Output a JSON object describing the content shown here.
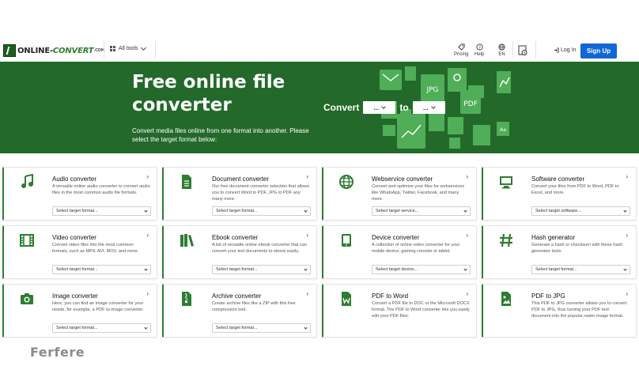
{
  "header": {
    "logo_main": "ONLINE-",
    "logo_accent": "CONVERT",
    "logo_suffix": ".COM",
    "all_tools": "All tools",
    "pricing": "Pricing",
    "help": "Help",
    "language": "EN",
    "login": "Log In",
    "signup": "Sign Up"
  },
  "hero": {
    "title": "Free online file converter",
    "subtitle": "Convert media files online from one format into another. Please select the target format below:",
    "convert_label": "Convert",
    "to_label": "to",
    "from_value": "...",
    "to_value": "...",
    "art_labels": [
      "JPG",
      "PDF",
      "Aa"
    ]
  },
  "cards": [
    {
      "title": "Audio converter",
      "desc": "A versatile online audio converter to convert audio files in the most common audio file formats.",
      "select": "Select target format...",
      "icon": "music-note-icon"
    },
    {
      "title": "Document converter",
      "desc": "Our free document converter selection that allows you to convert Word to PDF, JPG to PDF any many more.",
      "select": "Select target format...",
      "icon": "document-icon"
    },
    {
      "title": "Webservice converter",
      "desc": "Convert and optimize your files for webservices like WhatsApp, Twitter, Facebook, and many more.",
      "select": "Select target service...",
      "icon": "globe-icon"
    },
    {
      "title": "Software converter",
      "desc": "Convert your files from PDF to Word, PDF to Excel, and more.",
      "select": "Select target software...",
      "icon": "monitor-icon"
    },
    {
      "title": "Video converter",
      "desc": "Convert video files into the most common formats, such as MP4, AVI, MOV, and more.",
      "select": "Select target format...",
      "icon": "film-icon"
    },
    {
      "title": "Ebook converter",
      "desc": "A list of versatile online ebook converter that can convert your text documents to ebook easily.",
      "select": "Select target format...",
      "icon": "books-icon"
    },
    {
      "title": "Device converter",
      "desc": "A collection of online video converter for your mobile device, gaming console or tablet.",
      "select": "Select target device...",
      "icon": "tablet-icon"
    },
    {
      "title": "Hash generator",
      "desc": "Generate a hash or checksum with these hash generator tools.",
      "select": "Select target format...",
      "icon": "hash-icon"
    },
    {
      "title": "Image converter",
      "desc": "Here, you can find an image converter for your needs, for example, a PDF to image converter.",
      "select": "Select target format...",
      "icon": "camera-icon"
    },
    {
      "title": "Archive converter",
      "desc": "Create archive files like a ZIP with this free compression tool.",
      "select": "Select target format...",
      "icon": "archive-icon"
    },
    {
      "title": "PDF to Word",
      "desc": "Convert a PDF file to DOC or the Microsoft DOCX format. The PDF to Word converter lets you easily edit your PDF files.",
      "select": "",
      "icon": "word-file-icon"
    },
    {
      "title": "PDF to JPG",
      "desc": "This PDF to JPG converter allows you to convert PDF to JPG, thus turning your PDF text document into the popular raster image format.",
      "select": "",
      "icon": "image-file-icon"
    }
  ],
  "watermark": "Ferfere",
  "colors": {
    "brand_green": "#23692a",
    "accent_blue": "#0f67d8"
  }
}
